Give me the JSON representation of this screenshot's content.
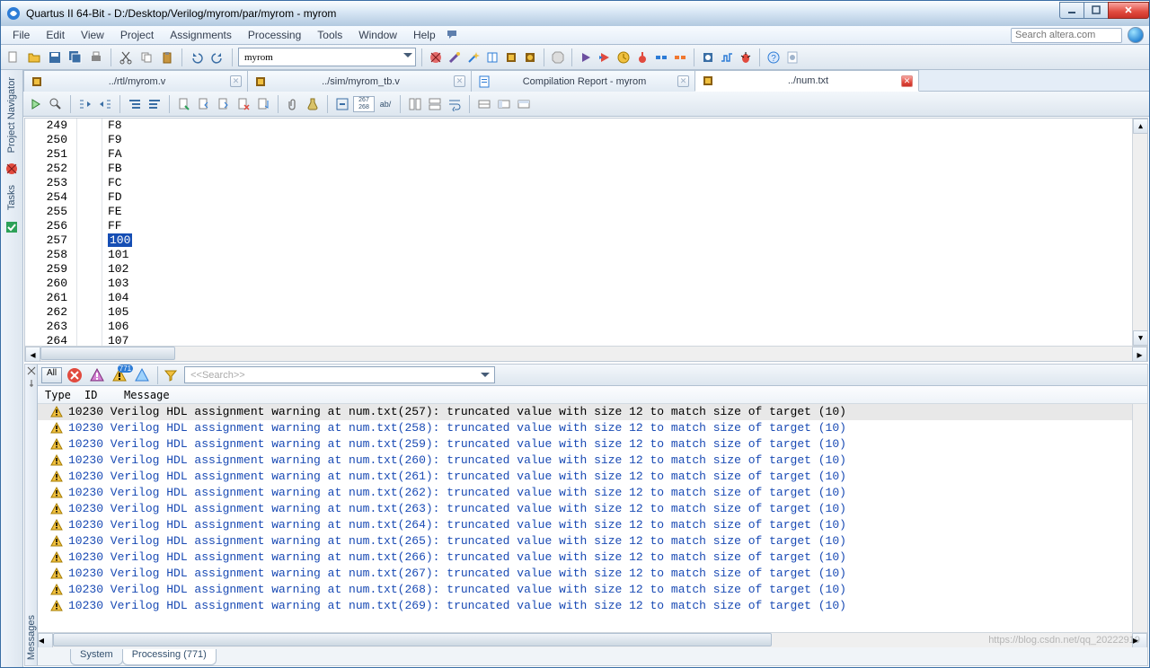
{
  "window": {
    "title": "Quartus II 64-Bit - D:/Desktop/Verilog/myrom/par/myrom - myrom"
  },
  "menubar": {
    "items": [
      "File",
      "Edit",
      "View",
      "Project",
      "Assignments",
      "Processing",
      "Tools",
      "Window",
      "Help"
    ],
    "search_placeholder": "Search altera.com"
  },
  "toolbar": {
    "combo_value": "myrom"
  },
  "tabs": [
    {
      "label": "../rtl/myrom.v",
      "active": false,
      "closeable": true
    },
    {
      "label": "../sim/myrom_tb.v",
      "active": false,
      "closeable": true
    },
    {
      "label": "Compilation Report - myrom",
      "active": false,
      "closeable": true
    },
    {
      "label": "../num.txt",
      "active": true,
      "closeable": true
    }
  ],
  "editor": {
    "lines": [
      {
        "num": "249",
        "text": "F8"
      },
      {
        "num": "250",
        "text": "F9"
      },
      {
        "num": "251",
        "text": "FA"
      },
      {
        "num": "252",
        "text": "FB"
      },
      {
        "num": "253",
        "text": "FC"
      },
      {
        "num": "254",
        "text": "FD"
      },
      {
        "num": "255",
        "text": "FE"
      },
      {
        "num": "256",
        "text": "FF"
      },
      {
        "num": "257",
        "text": "100",
        "selected": true
      },
      {
        "num": "258",
        "text": "101"
      },
      {
        "num": "259",
        "text": "102"
      },
      {
        "num": "260",
        "text": "103"
      },
      {
        "num": "261",
        "text": "104"
      },
      {
        "num": "262",
        "text": "105"
      },
      {
        "num": "263",
        "text": "106"
      },
      {
        "num": "264",
        "text": "107"
      }
    ],
    "editor_numbox": "267\n268",
    "ab_label": "ab/"
  },
  "messages": {
    "toolbar": {
      "all_label": "All",
      "warn_badge": "771",
      "search_placeholder": "<<Search>>"
    },
    "header": {
      "type": "Type",
      "id": "ID",
      "msg": "Message"
    },
    "rows": [
      {
        "sel": true,
        "text": "10230 Verilog HDL assignment warning at num.txt(257): truncated value with size 12 to match size of target (10)"
      },
      {
        "sel": false,
        "text": "10230 Verilog HDL assignment warning at num.txt(258): truncated value with size 12 to match size of target (10)"
      },
      {
        "sel": false,
        "text": "10230 Verilog HDL assignment warning at num.txt(259): truncated value with size 12 to match size of target (10)"
      },
      {
        "sel": false,
        "text": "10230 Verilog HDL assignment warning at num.txt(260): truncated value with size 12 to match size of target (10)"
      },
      {
        "sel": false,
        "text": "10230 Verilog HDL assignment warning at num.txt(261): truncated value with size 12 to match size of target (10)"
      },
      {
        "sel": false,
        "text": "10230 Verilog HDL assignment warning at num.txt(262): truncated value with size 12 to match size of target (10)"
      },
      {
        "sel": false,
        "text": "10230 Verilog HDL assignment warning at num.txt(263): truncated value with size 12 to match size of target (10)"
      },
      {
        "sel": false,
        "text": "10230 Verilog HDL assignment warning at num.txt(264): truncated value with size 12 to match size of target (10)"
      },
      {
        "sel": false,
        "text": "10230 Verilog HDL assignment warning at num.txt(265): truncated value with size 12 to match size of target (10)"
      },
      {
        "sel": false,
        "text": "10230 Verilog HDL assignment warning at num.txt(266): truncated value with size 12 to match size of target (10)"
      },
      {
        "sel": false,
        "text": "10230 Verilog HDL assignment warning at num.txt(267): truncated value with size 12 to match size of target (10)"
      },
      {
        "sel": false,
        "text": "10230 Verilog HDL assignment warning at num.txt(268): truncated value with size 12 to match size of target (10)"
      },
      {
        "sel": false,
        "text": "10230 Verilog HDL assignment warning at num.txt(269): truncated value with size 12 to match size of target (10)"
      }
    ],
    "bottom_tabs": {
      "system": "System",
      "processing": "Processing (771)"
    },
    "side_label": "Messages"
  },
  "sidebar": {
    "nav_label": "Project Navigator",
    "tasks_label": "Tasks"
  },
  "watermark": "https://blog.csdn.net/qq_20222919"
}
